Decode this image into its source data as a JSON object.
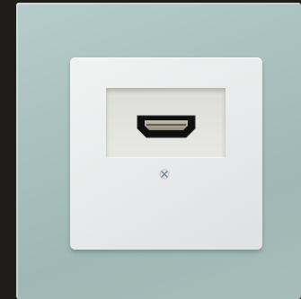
{
  "scene": {
    "description_icons": [
      "hdmi-port-icon",
      "screw-mark-icon"
    ],
    "colors": {
      "background": "#1f1d1b",
      "glass_plate": "#a9c1bf",
      "insert_plate": "#e7eaea",
      "recess": "#e0e0dc",
      "port_black": "#111111"
    }
  }
}
